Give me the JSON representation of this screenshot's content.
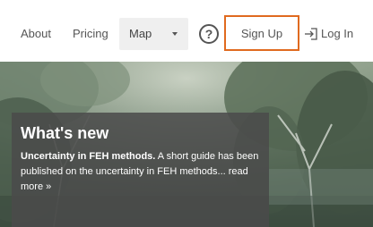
{
  "nav": {
    "about": "About",
    "pricing": "Pricing",
    "map": {
      "selected": "Map",
      "icon": "chevron-down-icon"
    },
    "help_glyph": "?",
    "sign_up": "Sign Up",
    "log_in": "Log In",
    "login_icon": "login-icon",
    "accent_color": "#e06a1f"
  },
  "news": {
    "heading": "What's new",
    "headline": "Uncertainty in FEH methods.",
    "summary": " A short guide has been published on the uncertainty in FEH methods... ",
    "read_more": "read more »"
  }
}
